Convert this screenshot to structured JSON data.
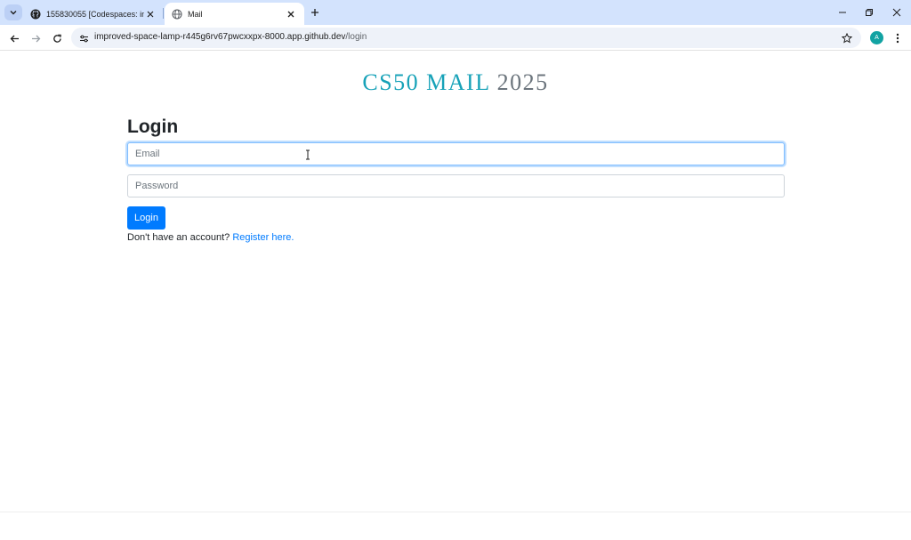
{
  "tabs": [
    {
      "title": "155830055 [Codespaces: impro",
      "favicon": "github-icon"
    },
    {
      "title": "Mail",
      "favicon": "globe-icon",
      "active": true
    }
  ],
  "address_bar": {
    "host": "improved-space-lamp-r445g6rv67pwcxxpx-8000.app.github.dev",
    "path": "/login"
  },
  "profile": {
    "initial": "A",
    "color": "#12a3a3"
  },
  "page": {
    "brand_accent": "CS50 MAIL",
    "brand_year": "2025",
    "heading": "Login",
    "email_placeholder": "Email",
    "password_placeholder": "Password",
    "login_button": "Login",
    "register_prompt": "Don't have an account?",
    "register_link": "Register here."
  },
  "colors": {
    "accent": "#17a2b8",
    "primary": "#007bff",
    "muted": "#6c757d"
  }
}
